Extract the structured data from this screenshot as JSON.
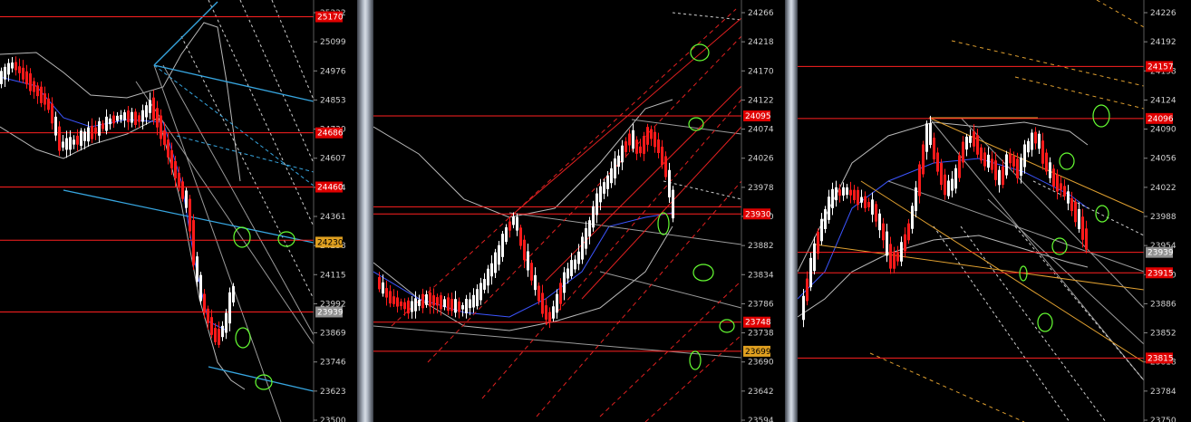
{
  "colors": {
    "background": "#000000",
    "bull_candle": "#ffffff",
    "bear_candle": "#ff1a1a",
    "level_line": "#ff2020",
    "channel_blue": "#37a6e0",
    "band": "#b8b8b8",
    "ma_blue": "#3c55ff",
    "axis_text": "#d0d0d0",
    "tag_red": "#e00000",
    "tag_orange": "#e0a020",
    "tag_gray": "#909090",
    "marker_green": "#66ff33"
  },
  "chart_data": [
    {
      "type": "candlestick",
      "ylim": [
        23480,
        25240
      ],
      "y_ticks": [
        "25222",
        "25099",
        "24976",
        "24853",
        "24730",
        "24607",
        "24484",
        "24361",
        "24238",
        "24115",
        "23992",
        "23869",
        "23746",
        "23623",
        "23500"
      ],
      "price_tags": [
        {
          "label": "25170",
          "color": "red"
        },
        {
          "label": "24686",
          "color": "red"
        },
        {
          "label": "24460",
          "color": "red"
        },
        {
          "label": "24230",
          "color": "orange"
        },
        {
          "label": "23939",
          "color": "gray"
        }
      ],
      "horizontal_levels": [
        25170,
        24686,
        24460,
        24238,
        23939
      ]
    },
    {
      "type": "candlestick",
      "ylim": [
        23580,
        24290
      ],
      "y_ticks": [
        "24266",
        "24218",
        "24170",
        "24122",
        "24074",
        "24026",
        "23978",
        "23930",
        "23882",
        "23834",
        "23786",
        "23738",
        "23690",
        "23642",
        "23594"
      ],
      "price_tags": [
        {
          "label": "24095",
          "color": "red"
        },
        {
          "label": "23930",
          "color": "red"
        },
        {
          "label": "23748",
          "color": "red"
        },
        {
          "label": "23699",
          "color": "orange"
        }
      ],
      "horizontal_levels": [
        24095,
        23942,
        23930,
        23748,
        23699
      ]
    },
    {
      "type": "candlestick",
      "ylim": [
        23740,
        24235
      ],
      "y_ticks": [
        "24226",
        "24192",
        "24158",
        "24124",
        "24090",
        "24056",
        "24022",
        "23988",
        "23954",
        "23920",
        "23886",
        "23852",
        "23818",
        "23784",
        "23750"
      ],
      "price_tags": [
        {
          "label": "24157",
          "color": "red"
        },
        {
          "label": "24096",
          "color": "red"
        },
        {
          "label": "23939",
          "color": "gray"
        },
        {
          "label": "23915",
          "color": "red"
        },
        {
          "label": "23815",
          "color": "red"
        }
      ],
      "horizontal_levels": [
        24157,
        24096,
        23939,
        23915,
        23815
      ]
    }
  ]
}
